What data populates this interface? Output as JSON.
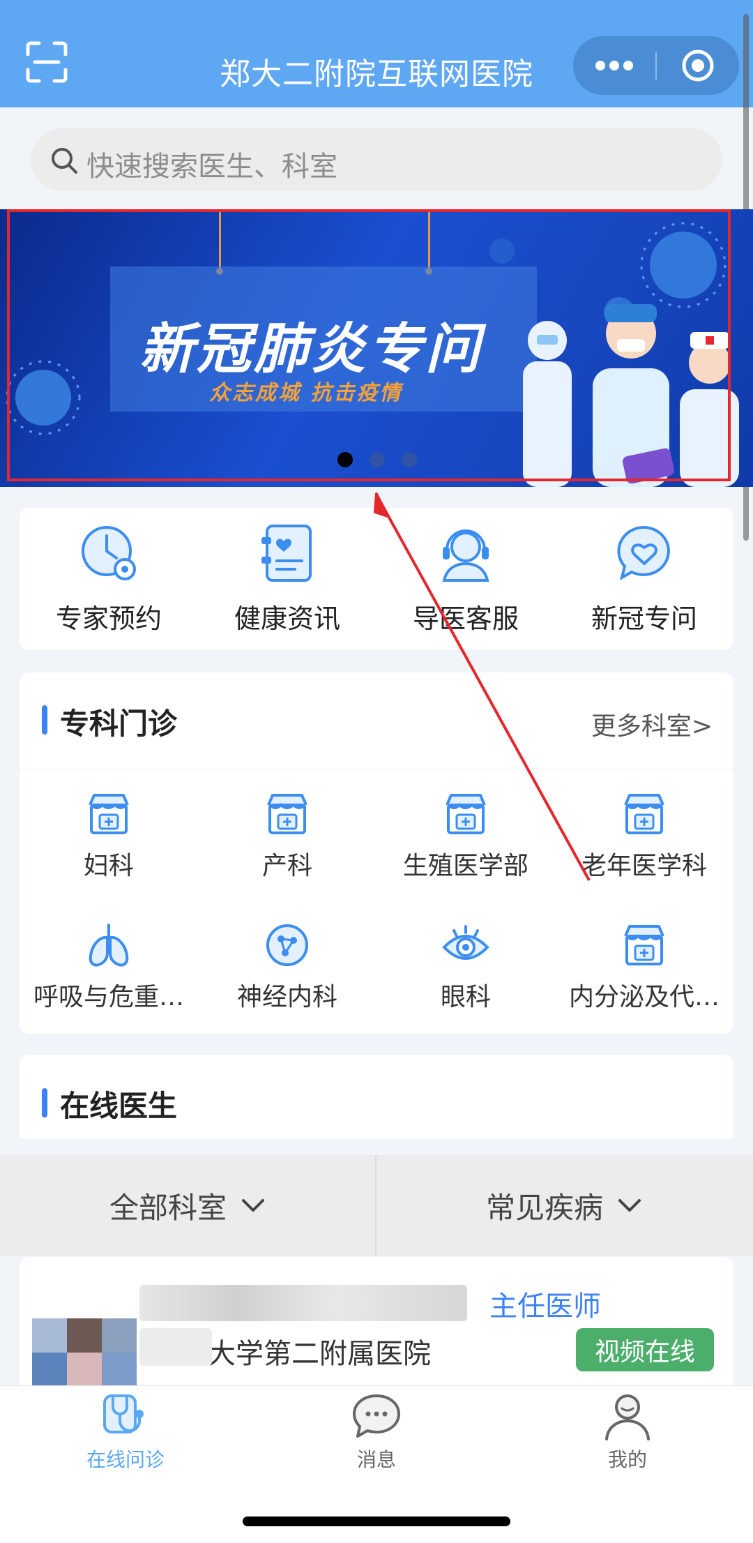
{
  "header": {
    "title": "郑大二附院互联网医院",
    "bg_color": "#5ea7f2",
    "icons": [
      "scan-icon",
      "more-dots-icon",
      "target-icon"
    ]
  },
  "search": {
    "placeholder": "快速搜索医生、科室",
    "icon": "search-icon"
  },
  "banner": {
    "headline": "新冠肺炎专问",
    "slogan": "众志成城  抗击疫情",
    "slide_count": 3,
    "active_slide": 1
  },
  "quick_links": [
    {
      "label": "专家预约",
      "icon": "clock-stethoscope-icon"
    },
    {
      "label": "健康资讯",
      "icon": "health-doc-icon"
    },
    {
      "label": "导医客服",
      "icon": "headset-icon"
    },
    {
      "label": "新冠专问",
      "icon": "heart-chat-icon"
    }
  ],
  "departments": {
    "title": "专科门诊",
    "more_label": "更多科室>",
    "items": [
      {
        "label": "妇科",
        "icon": "clinic-icon"
      },
      {
        "label": "产科",
        "icon": "clinic-icon"
      },
      {
        "label": "生殖医学部",
        "icon": "clinic-icon"
      },
      {
        "label": "老年医学科",
        "icon": "clinic-icon"
      },
      {
        "label": "呼吸与危重…",
        "icon": "lungs-icon"
      },
      {
        "label": "神经内科",
        "icon": "neuron-icon"
      },
      {
        "label": "眼科",
        "icon": "eye-icon"
      },
      {
        "label": "内分泌及代…",
        "icon": "clinic-icon"
      }
    ]
  },
  "online_doctors": {
    "title": "在线医生",
    "filters": [
      {
        "label": "全部科室",
        "icon": "chevron-down-icon"
      },
      {
        "label": "常见疾病",
        "icon": "chevron-down-icon"
      }
    ],
    "doctor": {
      "title": "主任医师",
      "hospital": "大学第二附属医院",
      "status": "视频在线"
    }
  },
  "tabbar": [
    {
      "label": "在线问诊",
      "icon": "stethoscope-icon",
      "active": true
    },
    {
      "label": "消息",
      "icon": "chat-bubble-icon",
      "active": false
    },
    {
      "label": "我的",
      "icon": "user-icon",
      "active": false
    }
  ],
  "colors": {
    "accent": "#3b82f6",
    "online_green": "#4cae6b",
    "annotation_red": "#e5262a"
  }
}
